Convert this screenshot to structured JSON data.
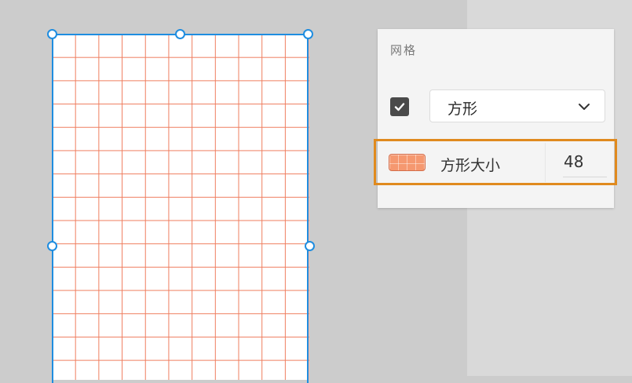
{
  "panel": {
    "title": "网格",
    "grid_enabled": true,
    "grid_type": {
      "selected": "方形"
    },
    "size_label": "方形大小",
    "size_value": "48"
  },
  "colors": {
    "grid_line": "#ef7d5e",
    "selection": "#1f8de0",
    "highlight": "#e08a1e",
    "swatch": "#f59870"
  },
  "icons": {
    "checkbox": "check-icon",
    "dropdown": "chevron-down-icon"
  }
}
